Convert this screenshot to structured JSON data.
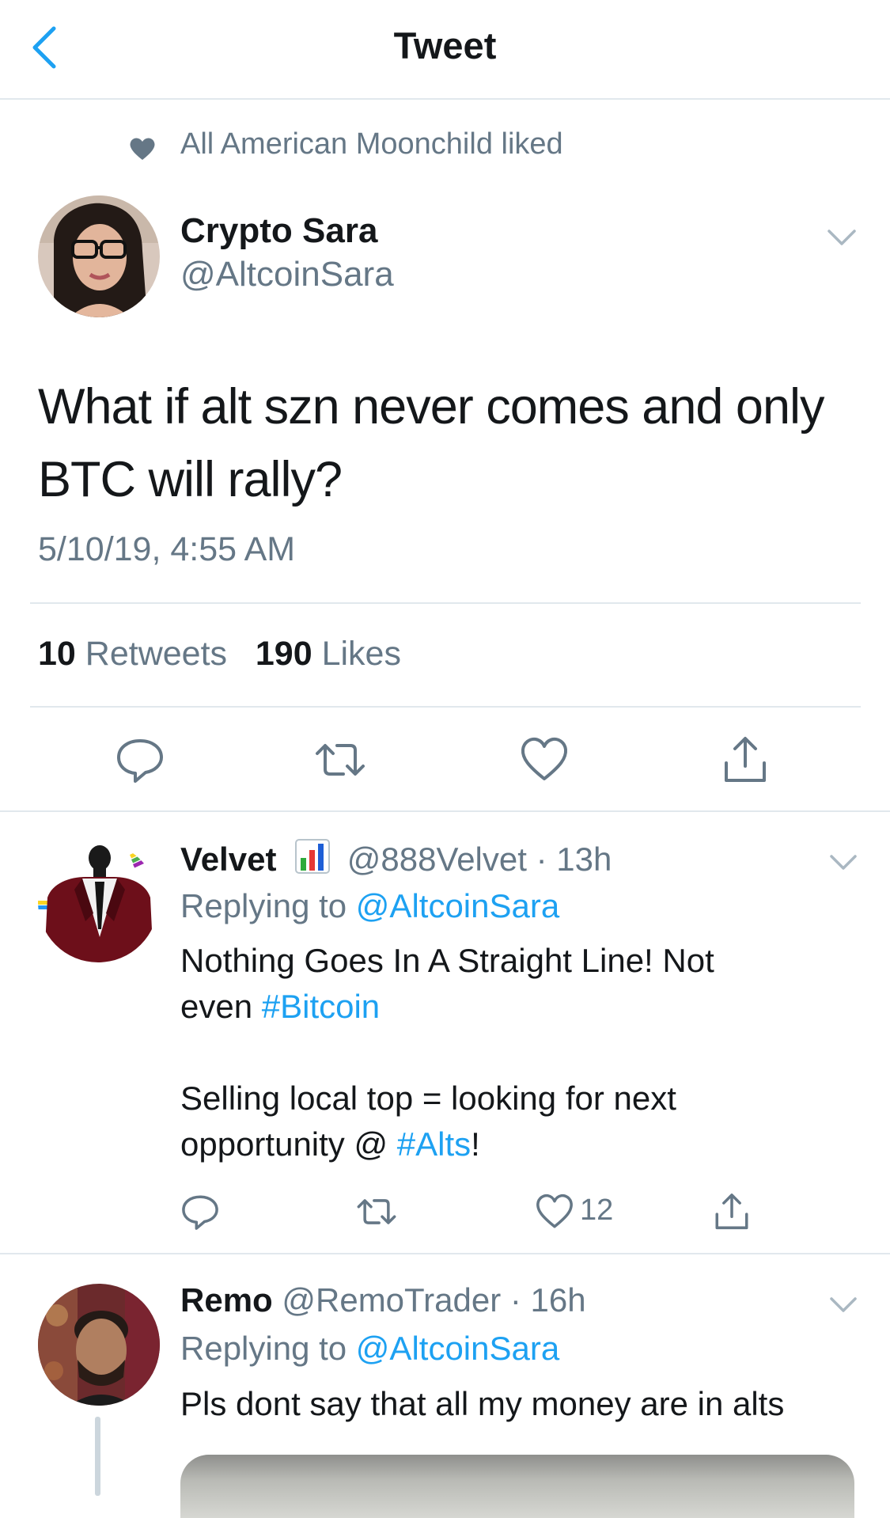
{
  "header": {
    "title": "Tweet",
    "back_icon": "chevron-left-icon"
  },
  "context": {
    "text": "All American Moonchild liked",
    "icon": "heart-icon"
  },
  "main_tweet": {
    "name": "Crypto Sara",
    "handle": "@AltcoinSara",
    "text": "What if alt szn never comes and only BTC will rally?",
    "timestamp": "5/10/19, 4:55 AM",
    "retweets_count": "10",
    "retweets_label": "Retweets",
    "likes_count": "190",
    "likes_label": "Likes",
    "actions": [
      "reply-icon",
      "retweet-icon",
      "like-icon",
      "share-icon"
    ]
  },
  "replies": [
    {
      "name": "Velvet",
      "emoji": "chart-emoji",
      "handle": "@888Velvet",
      "dot": "·",
      "time": "13h",
      "replying_prefix": "Replying to",
      "replying_to": "@AltcoinSara",
      "line1": "Nothing Goes In A Straight Line! Not",
      "line2_text": "even",
      "line2_tag": "#Bitcoin",
      "line3": "Selling local top = looking for next",
      "line4_text": "opportunity @",
      "line4_tag": "#Alts",
      "line4_end": "!",
      "like_count": "12"
    },
    {
      "name": "Remo",
      "handle": "@RemoTrader",
      "dot": "·",
      "time": "16h",
      "replying_prefix": "Replying to",
      "replying_to": "@AltcoinSara",
      "text": "Pls dont say that all my money are in alts"
    }
  ],
  "colors": {
    "accent": "#1da1f2",
    "secondary": "#657786",
    "divider": "#e1e8ed",
    "text": "#14171a"
  }
}
